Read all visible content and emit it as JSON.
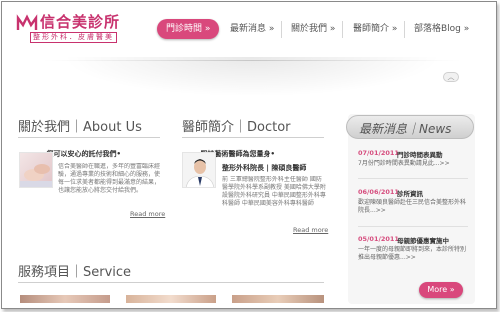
{
  "logo": {
    "title": "信合美診所",
    "subtitle": "整形外科．皮膚醫美"
  },
  "nav": {
    "items": [
      {
        "label": "門診時間 »"
      },
      {
        "label": "最新消息 »"
      },
      {
        "label": "關於我們 »"
      },
      {
        "label": "醫師簡介 »"
      },
      {
        "label": "部落格Blog »"
      }
    ]
  },
  "scroll_button": {
    "icon": "chevron-up-icon"
  },
  "about": {
    "title": "關於我們｜About Us",
    "headline": "•您可以安心的託付我們•",
    "body": "信合美醫師在職進，多年的豐富臨床經驗，通過專業的技術和細心的服務，使每一位求美者都能得到最滿意的結果，也讓您能放心將您交付給我們。",
    "read_more": "Read more"
  },
  "doctor": {
    "title": "醫師簡介｜Doctor",
    "headline": "•堅持藝術醫師為您量身•",
    "role": "整形外科院長 | 陳碩良醫師",
    "body": "前 三軍總醫院整形外科主任醫師 國防醫學院外科學系副教授 美國哈佛大學附設醫院外科研究員 中華民國整形外科專科醫師 中華民國美容外科專科醫師",
    "read_more": "Read more"
  },
  "news": {
    "title": "最新消息｜News",
    "items": [
      {
        "date": "07/01/2011",
        "title": "門診時間表異動",
        "desc": "7月份門診時間表異動請見此...>>"
      },
      {
        "date": "06/06/2011",
        "title": "診所資訊",
        "desc": "歡迎陳碩良醫師赴任三民信合美整形外科院長...>>"
      },
      {
        "date": "05/01/2011",
        "title": "母親節優惠實施中",
        "desc": "一年一度的母親節即將到來，本診所特別推出母親節優惠...>>"
      }
    ],
    "more_label": "More »"
  },
  "service": {
    "title": "服務項目｜Service"
  },
  "colors": {
    "accent": "#d9487c",
    "news_date": "#d64d7e"
  }
}
